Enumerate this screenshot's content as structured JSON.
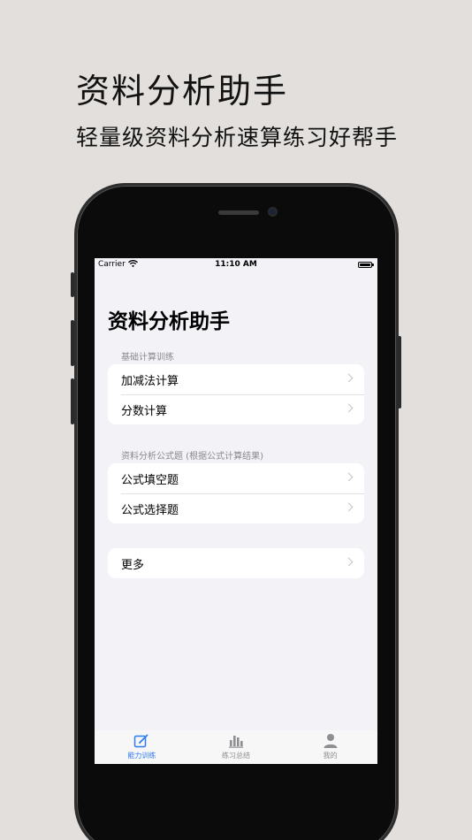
{
  "promo": {
    "title": "资料分析助手",
    "subtitle": "轻量级资料分析速算练习好帮手"
  },
  "status_bar": {
    "carrier": "Carrier",
    "time": "11:10 AM"
  },
  "screen": {
    "title": "资料分析助手",
    "sections": [
      {
        "header": "基础计算训练",
        "items": [
          {
            "label": "加减法计算"
          },
          {
            "label": "分数计算"
          }
        ]
      },
      {
        "header": "资料分析公式题 (根据公式计算结果)",
        "items": [
          {
            "label": "公式填空题"
          },
          {
            "label": "公式选择题"
          }
        ]
      },
      {
        "header": "",
        "items": [
          {
            "label": "更多"
          }
        ]
      }
    ]
  },
  "tab_bar": {
    "tabs": [
      {
        "label": "能力训练",
        "icon": "edit-icon",
        "active": true
      },
      {
        "label": "练习总结",
        "icon": "bar-chart-icon",
        "active": false
      },
      {
        "label": "我的",
        "icon": "person-icon",
        "active": false
      }
    ]
  },
  "colors": {
    "background": "#e2dfdc",
    "accent": "#2f7cf6",
    "screen_bg": "#f2f2f7"
  }
}
